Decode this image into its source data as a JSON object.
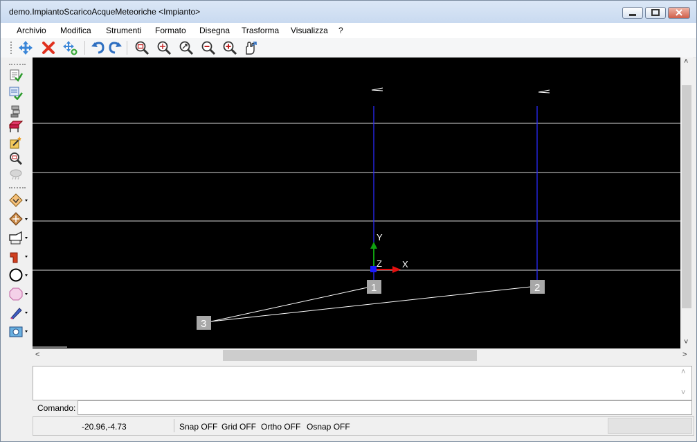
{
  "window": {
    "title": "demo.ImpiantoScaricoAcqueMeteoriche <Impianto>"
  },
  "menu": [
    "Archivio",
    "Modifica",
    "Strumenti",
    "Formato",
    "Disegna",
    "Trasforma",
    "Visualizza",
    "?"
  ],
  "toolbar_icons": [
    "move-icon",
    "delete-icon",
    "copy-icon",
    "undo-icon",
    "redo-icon",
    "zoom-window-icon",
    "zoom-all-icon",
    "zoom-extents-icon",
    "zoom-out-icon",
    "zoom-in-icon",
    "pan-icon"
  ],
  "left_toolbar_icons": [
    "properties-icon",
    "verify-icon",
    "elements-icon",
    "table-icon",
    "wizard-icon",
    "zoom-find-icon",
    "rain-icon",
    "node-icon",
    "junction-icon",
    "fitting-icon",
    "pipe-icon",
    "circle-icon",
    "polygon-icon",
    "pen-icon",
    "camera-icon"
  ],
  "canvas": {
    "node_labels": [
      "1",
      "2",
      "3"
    ],
    "axis_labels": {
      "x": "X",
      "y": "Y",
      "z": "Z"
    }
  },
  "command": {
    "label": "Comando:",
    "value": ""
  },
  "status": {
    "coords": "-20.96,-4.73",
    "snap": "Snap OFF",
    "grid": "Grid OFF",
    "ortho": "Ortho OFF",
    "osnap": "Osnap OFF"
  },
  "colors": {
    "canvas_bg": "#000000",
    "pipe": "#2a2aff",
    "x_axis": "#e51010",
    "y_axis": "#10a010",
    "origin": "#1a1aff"
  }
}
